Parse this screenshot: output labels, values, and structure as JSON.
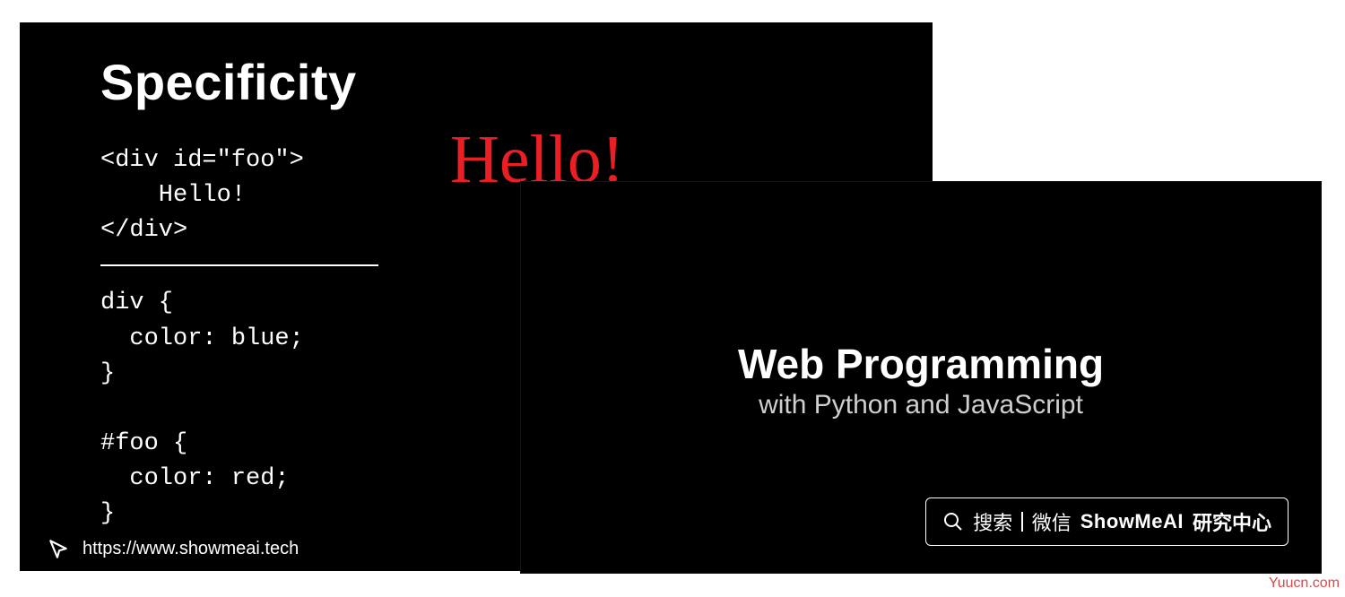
{
  "slide_back": {
    "title": "Specificity",
    "code_html": "<div id=\"foo\">\n    Hello!\n</div>",
    "code_css": "div {\n  color: blue;\n}\n\n#foo {\n  color: red;\n}",
    "output": "Hello!",
    "footer_url": "https://www.showmeai.tech"
  },
  "slide_front": {
    "title": "Web Programming",
    "subtitle": "with Python and JavaScript",
    "search": {
      "label": "搜索",
      "platform": "微信",
      "brand": "ShowMeAI",
      "tail": "研究中心"
    }
  },
  "watermark": "Yuucn.com"
}
